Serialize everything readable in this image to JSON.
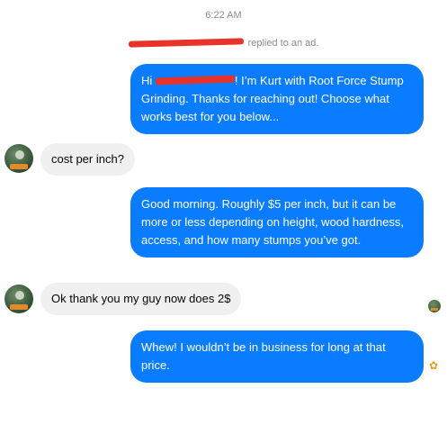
{
  "conversation": {
    "timestamp": "6:22 AM",
    "system_message": {
      "suffix": "replied to an ad."
    },
    "messages": [
      {
        "direction": "outgoing",
        "before": "Hi ",
        "after": "! I’m Kurt with Root Force Stump Grinding. Thanks for reaching out! Choose what works best for you below..."
      },
      {
        "direction": "incoming",
        "text": "cost per inch?"
      },
      {
        "direction": "outgoing",
        "text": "Good morning.  Roughly $5 per inch, but it can be more or less depending on height, wood hardness, access, and how many stumps you’ve got."
      },
      {
        "direction": "incoming",
        "text": "Ok thank you my guy now does 2$"
      },
      {
        "direction": "outgoing",
        "text": "Whew! I wouldn’t be in business for long at that price."
      }
    ],
    "reaction_icon": "sticker-icon",
    "reaction_glyph": "✿"
  },
  "colors": {
    "outgoing_bubble": "#0a7cff",
    "incoming_bubble": "#f0f0f0",
    "meta_text": "#8a8d91",
    "redaction": "#e8332a"
  }
}
